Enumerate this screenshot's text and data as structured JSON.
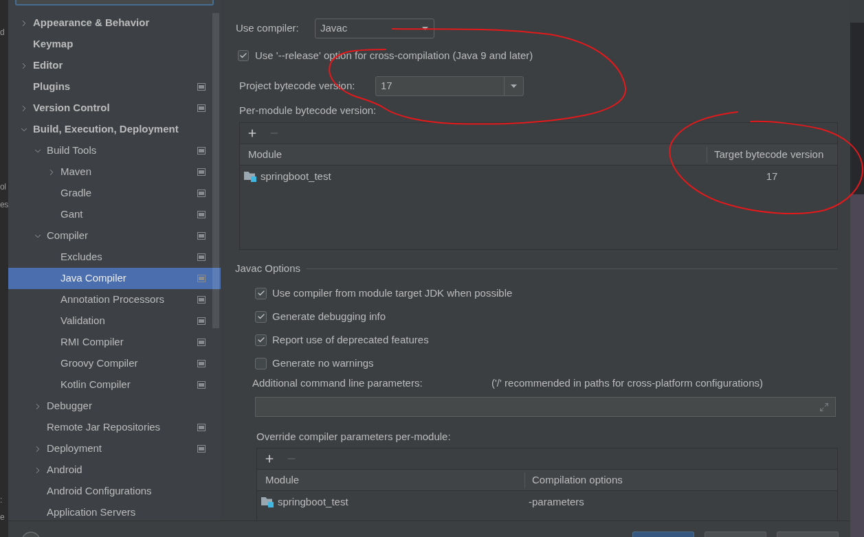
{
  "background_editor": {
    "fragments": [
      "d",
      "ol",
      "es",
      ":",
      "e"
    ]
  },
  "sidebar": {
    "items": [
      {
        "label": "Appearance & Behavior",
        "kind": "group",
        "expanded": false,
        "selected": false,
        "project_specific": false
      },
      {
        "label": "Keymap",
        "kind": "page",
        "selected": false,
        "project_specific": false
      },
      {
        "label": "Editor",
        "kind": "group",
        "expanded": false,
        "selected": false,
        "project_specific": false
      },
      {
        "label": "Plugins",
        "kind": "page",
        "selected": false,
        "project_specific": true
      },
      {
        "label": "Version Control",
        "kind": "group",
        "expanded": false,
        "selected": false,
        "project_specific": true
      },
      {
        "label": "Build, Execution, Deployment",
        "kind": "group",
        "expanded": true,
        "selected": false,
        "project_specific": false,
        "children": [
          {
            "label": "Build Tools",
            "kind": "group",
            "expanded": true,
            "selected": false,
            "project_specific": true,
            "children": [
              {
                "label": "Maven",
                "kind": "group",
                "expanded": false,
                "selected": false,
                "project_specific": true
              },
              {
                "label": "Gradle",
                "kind": "page",
                "selected": false,
                "project_specific": true
              },
              {
                "label": "Gant",
                "kind": "page",
                "selected": false,
                "project_specific": true
              }
            ]
          },
          {
            "label": "Compiler",
            "kind": "group",
            "expanded": true,
            "selected": false,
            "project_specific": true,
            "children": [
              {
                "label": "Excludes",
                "kind": "page",
                "selected": false,
                "project_specific": true
              },
              {
                "label": "Java Compiler",
                "kind": "page",
                "selected": true,
                "project_specific": true
              },
              {
                "label": "Annotation Processors",
                "kind": "page",
                "selected": false,
                "project_specific": true
              },
              {
                "label": "Validation",
                "kind": "page",
                "selected": false,
                "project_specific": true
              },
              {
                "label": "RMI Compiler",
                "kind": "page",
                "selected": false,
                "project_specific": true
              },
              {
                "label": "Groovy Compiler",
                "kind": "page",
                "selected": false,
                "project_specific": true
              },
              {
                "label": "Kotlin Compiler",
                "kind": "page",
                "selected": false,
                "project_specific": true
              }
            ]
          },
          {
            "label": "Debugger",
            "kind": "group",
            "expanded": false,
            "selected": false,
            "project_specific": false
          },
          {
            "label": "Remote Jar Repositories",
            "kind": "page",
            "selected": false,
            "project_specific": true
          },
          {
            "label": "Deployment",
            "kind": "group",
            "expanded": false,
            "selected": false,
            "project_specific": true
          },
          {
            "label": "Android",
            "kind": "group",
            "expanded": false,
            "selected": false,
            "project_specific": false
          },
          {
            "label": "Android Configurations",
            "kind": "page",
            "selected": false,
            "project_specific": false
          },
          {
            "label": "Application Servers",
            "kind": "page",
            "selected": false,
            "project_specific": false
          }
        ]
      }
    ]
  },
  "compiler_select": {
    "label": "Use compiler:",
    "value": "Javac"
  },
  "release_option": {
    "label": "Use '--release' option for cross-compilation (Java 9 and later)",
    "checked": true
  },
  "project_bytecode": {
    "label": "Project bytecode version:",
    "value": "17"
  },
  "per_module_bytecode": {
    "label": "Per-module bytecode version:",
    "toolbar": [
      {
        "kind": "add",
        "disabled": false
      },
      {
        "kind": "remove",
        "disabled": true
      }
    ],
    "columns": [
      "Module",
      "Target bytecode version"
    ],
    "rows": [
      {
        "module": "springboot_test",
        "target_version": "17"
      }
    ]
  },
  "javac_options": {
    "title": "Javac Options",
    "options": [
      {
        "label": "Use compiler from module target JDK when possible",
        "checked": true
      },
      {
        "label": "Generate debugging info",
        "checked": true
      },
      {
        "label": "Report use of deprecated features",
        "checked": true
      },
      {
        "label": "Generate no warnings",
        "checked": false
      }
    ],
    "additional_parameters": {
      "label": "Additional command line parameters:",
      "hint": "('/' recommended in paths for cross-platform configurations)"
    },
    "override": {
      "label": "Override compiler parameters per-module:",
      "toolbar": [
        {
          "kind": "add",
          "disabled": false
        },
        {
          "kind": "remove",
          "disabled": true
        }
      ],
      "columns": [
        "Module",
        "Compilation options"
      ],
      "rows": [
        {
          "module": "springboot_test",
          "options": "-parameters"
        }
      ]
    }
  },
  "footer": {
    "buttons": [
      {
        "default": true
      },
      {
        "default": false
      },
      {
        "default": false
      }
    ]
  }
}
